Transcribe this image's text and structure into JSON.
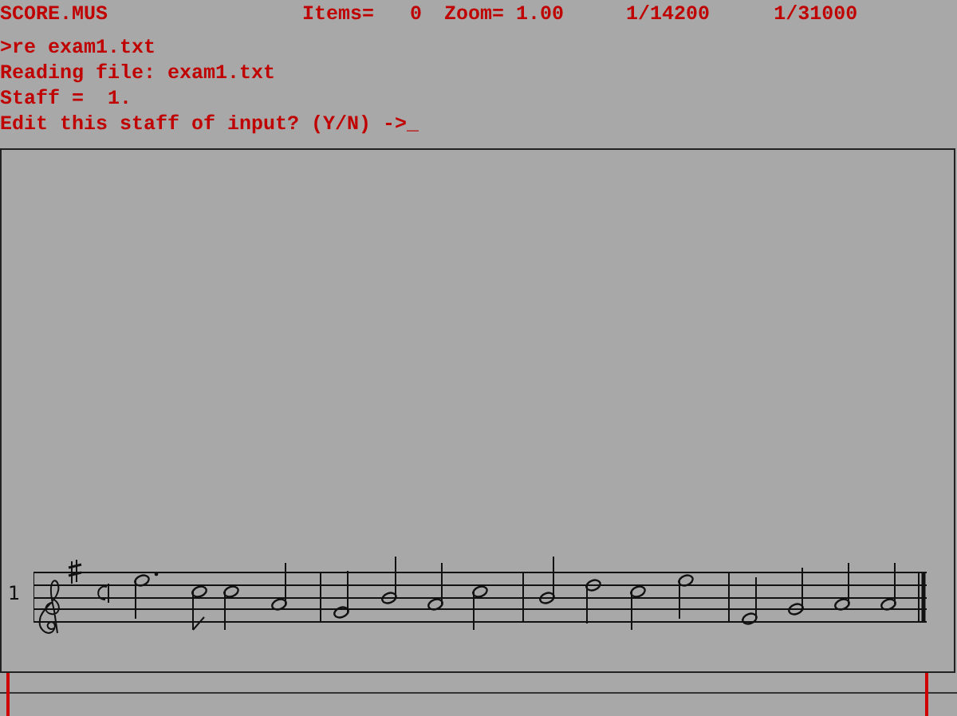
{
  "status_bar": {
    "file": "SCORE.MUS",
    "items": "Items=   0",
    "zoom": "Zoom= 1.00",
    "position_1": "1/14200",
    "position_2": "1/31000"
  },
  "console": [
    ">re exam1.txt",
    "Reading file: exam1.txt",
    "Staff =  1.",
    "Edit this staff of input? (Y/N) ->_"
  ],
  "staff": {
    "number": "1"
  }
}
